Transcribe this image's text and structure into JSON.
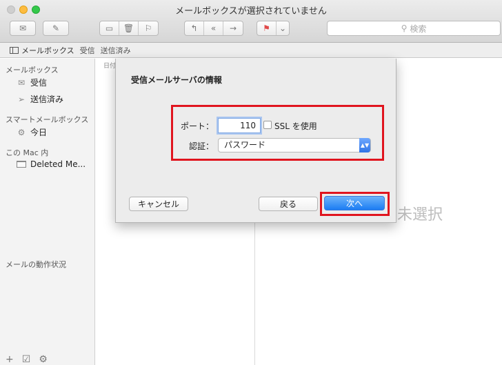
{
  "window": {
    "title": "メールボックスが選択されていません"
  },
  "toolbar": {
    "search_placeholder": "検索",
    "icons": [
      "compose-envelope-icon",
      "new-message-icon",
      "archive-icon",
      "trash-icon",
      "junk-icon",
      "reply-icon",
      "reply-all-icon",
      "forward-icon",
      "flag-icon"
    ]
  },
  "favorites": {
    "mailboxes": "メールボックス",
    "inbox": "受信",
    "sent": "送信済み"
  },
  "sidebar": {
    "mailboxes_header": "メールボックス",
    "inbox": "受信",
    "sent": "送信済み",
    "smart_header": "スマートメールボックス",
    "today": "今日",
    "on_mac_header": "この Mac 内",
    "deleted": "Deleted Me...",
    "activity_header": "メールの動作状況"
  },
  "list": {
    "sort_label": "日付"
  },
  "message": {
    "no_selection": "未選択"
  },
  "dialog": {
    "title": "受信メールサーバの情報",
    "port_label": "ポート：",
    "port_value": "110",
    "ssl_label": "SSL を使用",
    "ssl_checked": false,
    "auth_label": "認証：",
    "auth_value": "パスワード",
    "cancel": "キャンセル",
    "back": "戻る",
    "next": "次へ"
  },
  "colors": {
    "highlight": "#e0141e",
    "primary_button": "#1b7cf3",
    "close": "#fc605c",
    "minimize": "#fdbc40",
    "zoom": "#34c84a"
  }
}
